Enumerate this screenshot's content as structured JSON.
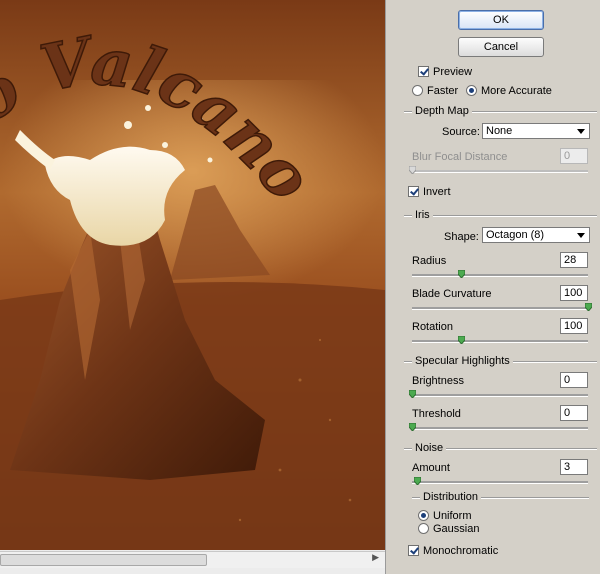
{
  "buttons": {
    "ok": "OK",
    "cancel": "Cancel"
  },
  "preview": {
    "checkbox_label": "Preview",
    "checked": true,
    "mode_faster": "Faster",
    "mode_accurate": "More Accurate",
    "selected_mode": "More Accurate",
    "title_text": "o Valcano"
  },
  "depth_map": {
    "title": "Depth Map",
    "source_label": "Source:",
    "source_value": "None",
    "blur_focal_label": "Blur Focal Distance",
    "blur_focal_value": "0",
    "blur_focal_disabled": true,
    "invert_label": "Invert",
    "invert_checked": true
  },
  "iris": {
    "title": "Iris",
    "shape_label": "Shape:",
    "shape_value": "Octagon (8)",
    "radius_label": "Radius",
    "radius_value": "28",
    "radius_fraction": 0.28,
    "blade_label": "Blade Curvature",
    "blade_value": "100",
    "blade_fraction": 1.0,
    "rotation_label": "Rotation",
    "rotation_value": "100",
    "rotation_fraction": 0.28
  },
  "specular": {
    "title": "Specular Highlights",
    "brightness_label": "Brightness",
    "brightness_value": "0",
    "brightness_fraction": 0,
    "threshold_label": "Threshold",
    "threshold_value": "0",
    "threshold_fraction": 0
  },
  "noise": {
    "title": "Noise",
    "amount_label": "Amount",
    "amount_value": "3",
    "amount_fraction": 0.03,
    "distribution_title": "Distribution",
    "uniform_label": "Uniform",
    "gaussian_label": "Gaussian",
    "selected_distribution": "Uniform",
    "mono_label": "Monochromatic",
    "mono_checked": true
  },
  "colors": {
    "chocolate": "#6b3317",
    "cream": "#f5edd5",
    "button_border": "#4a6ea9"
  }
}
